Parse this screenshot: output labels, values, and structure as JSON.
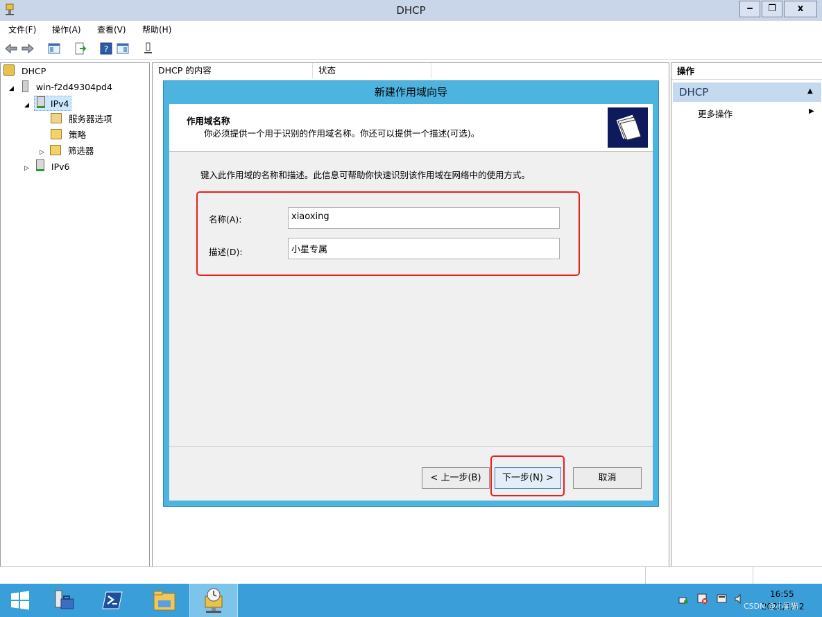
{
  "window": {
    "title": "DHCP"
  },
  "window_controls": {
    "minimize": "‒",
    "restore": "❐",
    "close": "x"
  },
  "menu": [
    "文件(F)",
    "操作(A)",
    "查看(V)",
    "帮助(H)"
  ],
  "tree": {
    "root": "DHCP",
    "server": "win-f2d49304pd4",
    "ipv4": "IPv4",
    "ipv4_children": [
      "服务器选项",
      "策略",
      "筛选器"
    ],
    "ipv6": "IPv6"
  },
  "center": {
    "columns": [
      "DHCP 的内容",
      "状态"
    ]
  },
  "actions": {
    "header": "操作",
    "section": "DHCP",
    "more": "更多操作"
  },
  "dialog": {
    "title": "新建作用域向导",
    "heading": "作用域名称",
    "subheading": "你必须提供一个用于识别的作用域名称。你还可以提供一个描述(可选)。",
    "instruction": "键入此作用域的名称和描述。此信息可帮助你快速识别该作用域在网络中的使用方式。",
    "name_label": "名称(A):",
    "name_value": "xiaoxing",
    "desc_label": "描述(D):",
    "desc_value": "小星专属",
    "back_button": "< 上一步(B)",
    "next_button": "下一步(N) >",
    "cancel_button": "取消"
  },
  "taskbar": {
    "time": "16:55",
    "date": "2022/1/12",
    "watermark": "CSDN @小星猫"
  },
  "colors": {
    "dialog_frame": "#4cb4de",
    "taskbar": "#3a9ed8",
    "highlight": "#e81f1f",
    "action_section": "#c5d9ef"
  }
}
